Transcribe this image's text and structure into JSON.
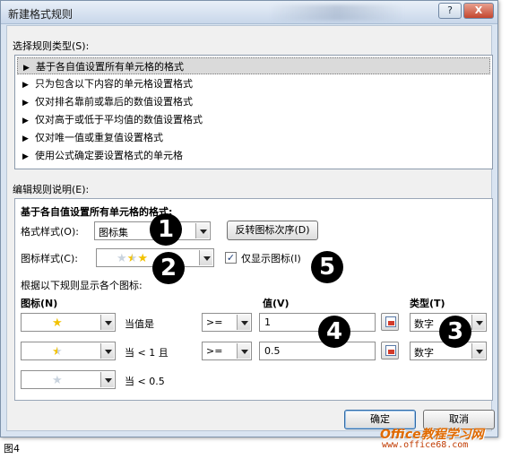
{
  "window": {
    "title": "新建格式规则",
    "help_label": "?",
    "close_label": "X"
  },
  "rule_type": {
    "label": "选择规则类型(S):",
    "items": [
      {
        "label": "基于各自值设置所有单元格的格式",
        "selected": true
      },
      {
        "label": "只为包含以下内容的单元格设置格式",
        "selected": false
      },
      {
        "label": "仅对排名靠前或靠后的数值设置格式",
        "selected": false
      },
      {
        "label": "仅对高于或低于平均值的数值设置格式",
        "selected": false
      },
      {
        "label": "仅对唯一值或重复值设置格式",
        "selected": false
      },
      {
        "label": "使用公式确定要设置格式的单元格",
        "selected": false
      }
    ]
  },
  "edit": {
    "label": "编辑规则说明(E):",
    "heading": "基于各自值设置所有单元格的格式:",
    "format_style_label": "格式样式(O):",
    "format_style_value": "图标集",
    "reverse_button": "反转图标次序(D)",
    "icon_style_label": "图标样式(C):",
    "show_icon_only_label": "仅显示图标(I)",
    "show_icon_only_checked": true,
    "rules_caption": "根据以下规则显示各个图标:",
    "col_icon": "图标(N)",
    "col_value": "值(V)",
    "col_type": "类型(T)",
    "rows": [
      {
        "icon": "star-full",
        "condition": "当值是",
        "operator": ">=",
        "value": "1",
        "type": "数字"
      },
      {
        "icon": "star-half",
        "condition": "当 < 1 且",
        "operator": ">=",
        "value": "0.5",
        "type": "数字"
      },
      {
        "icon": "star-empty",
        "condition": "当 < 0.5",
        "operator": "",
        "value": "",
        "type": ""
      }
    ]
  },
  "buttons": {
    "ok": "确定",
    "cancel": "取消"
  },
  "callouts": [
    "1",
    "2",
    "3",
    "4",
    "5"
  ],
  "caption": "图4",
  "watermark": {
    "line1": "Office教程学习网",
    "line2": "www.office68.com"
  },
  "colors": {
    "star": "#f2c200",
    "dialog_frame": "#d9e4f1",
    "watermark": "#e06a00"
  }
}
